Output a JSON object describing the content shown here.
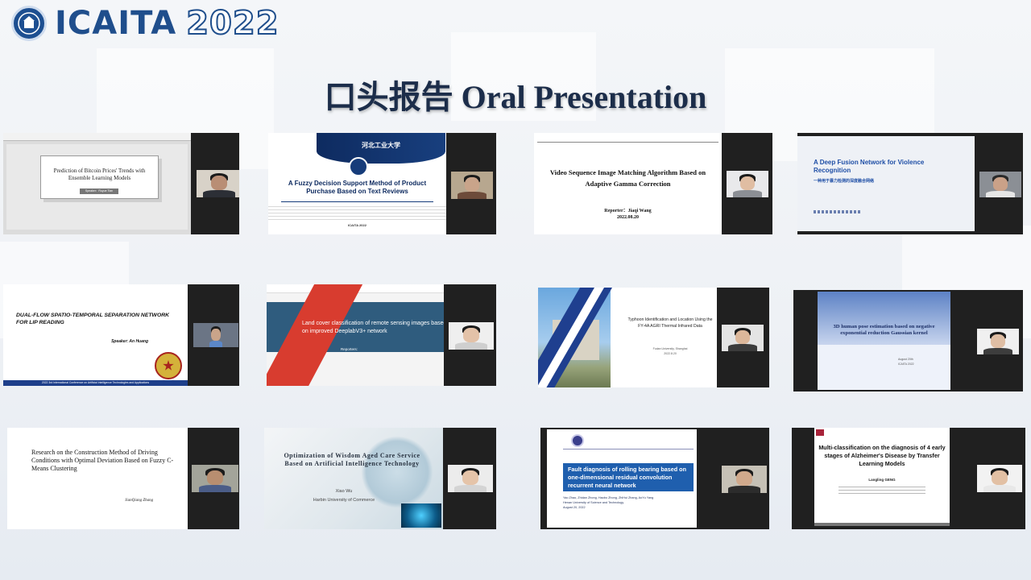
{
  "header": {
    "logo_main": "ICAITA",
    "logo_year": "2022",
    "logo_icon": "university-seal-icon"
  },
  "page_title": "口头报告 Oral Presentation",
  "thumbnails": [
    {
      "title": "Prediction of Bitcoin Prices' Trends with Ensemble Learning Models",
      "speaker": "Speaker：Ruyue Tian"
    },
    {
      "title": "A Fuzzy Decision Support Method of Product Purchase Based on Text Reviews",
      "footer": "ICAITA 2022",
      "banner_text": "河北工业大学"
    },
    {
      "title": "Video Sequence Image Matching Algorithm Based on Adaptive Gamma Correction",
      "reporter": "Reporter：Jiaqi Wang",
      "date": "2022.08.20"
    },
    {
      "title": "A Deep Fusion Network for Violence Recognition",
      "subtitle_cn": "一种用于暴力检测的深度融合网络"
    },
    {
      "title": "DUAL-FLOW SPATIO-TEMPORAL SEPARATION NETWORK FOR LIP READING",
      "speaker": "Speaker: An Huang",
      "footer": "2022 3rd International Conference on Artificial Intelligence Technologies and Applications"
    },
    {
      "title": "Land cover classification of remote sensing images based on improved DeeplabV3+ network",
      "reporters_label": "Reporters:"
    },
    {
      "title": "Typhoon Identification and Location Using the FY-4A AGRI Thermal Infrared Data",
      "affiliation": "Fudan University, Shanghai",
      "date": "2022.8.20"
    },
    {
      "title": "3D human pose estimation based on negative exponential reduction Gaussian kernel",
      "date": "August 20th",
      "conf": "ICAITA 2022"
    },
    {
      "title": "Research on the Construction Method of Driving Conditions with Optimal Deviation Based on Fuzzy C-Means Clustering",
      "author": "JianQiang Zhang"
    },
    {
      "title": "Optimization of Wisdom Aged Care Service Based on Artificial Intelligence Technology",
      "author": "Xiao Wu",
      "affiliation": "Harbin University of Commerce"
    },
    {
      "title": "Fault diagnosis of rolling bearing based on one-dimensional residual convolution recurrent neural network",
      "bullets": [
        "Yao Zhao, Zhidan Zhong, Haobo Zhong, ZhiHui Zhang, AoYu Yang",
        "Henan University of Science and Technology",
        "August 20, 2022"
      ]
    },
    {
      "title": "Multi-classification on the diagnosis of 4 early stages of Alzheimer's Disease by Transfer Learning Models",
      "author": "Langling GENG"
    }
  ]
}
